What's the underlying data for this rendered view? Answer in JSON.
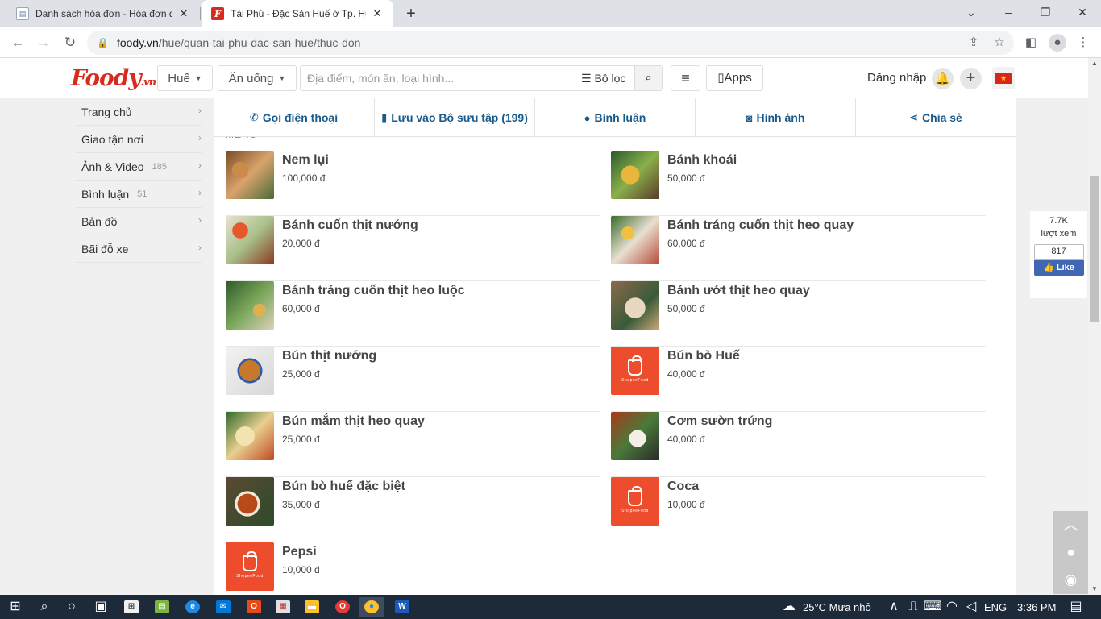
{
  "browser": {
    "tabs": [
      {
        "title": "Danh sách hóa đơn - Hóa đơn điện tử",
        "active": false
      },
      {
        "title": "Tài Phú - Đặc Sản Huế ở Tp. Huế",
        "active": true
      }
    ],
    "url_host": "foody.vn",
    "url_path": "/hue/quan-tai-phu-dac-san-hue/thuc-don"
  },
  "header": {
    "logo_text": "Foody",
    "logo_suffix": ".vn",
    "city": "Huế",
    "category": "Ăn uống",
    "search_placeholder": "Địa điểm, món ăn, loại hình...",
    "filter_label": "Bộ lọc",
    "apps_label": "Apps",
    "login_label": "Đăng nhập",
    "flag_symbol": "★"
  },
  "sidebar": {
    "items": [
      {
        "label": "Trang chủ",
        "count": ""
      },
      {
        "label": "Giao tận nơi",
        "count": ""
      },
      {
        "label": "Ảnh & Video",
        "count": "185"
      },
      {
        "label": "Bình luận",
        "count": "51"
      },
      {
        "label": "Bản đồ",
        "count": ""
      },
      {
        "label": "Bãi đỗ xe",
        "count": ""
      }
    ]
  },
  "actions": [
    {
      "label": "Gọi điện thoại",
      "icon": "phone-icon"
    },
    {
      "label": "Lưu vào Bộ sưu tập (199)",
      "icon": "bookmark-icon"
    },
    {
      "label": "Bình luận",
      "icon": "comment-icon"
    },
    {
      "label": "Hình ảnh",
      "icon": "camera-icon"
    },
    {
      "label": "Chia sẻ",
      "icon": "share-icon"
    }
  ],
  "menu": {
    "heading": "MENU",
    "left": [
      {
        "name": "Nem lụi",
        "price": "100,000 đ",
        "image": "photo-grill"
      },
      {
        "name": "Bánh cuốn thịt nướng",
        "price": "20,000 đ",
        "image": "photo-rolls"
      },
      {
        "name": "Bánh tráng cuốn thịt heo luộc",
        "price": "60,000 đ",
        "image": "photo-herbs"
      },
      {
        "name": "Bún thịt nướng",
        "price": "25,000 đ",
        "image": "photo-noodle"
      },
      {
        "name": "Bún mắm thịt heo quay",
        "price": "25,000 đ",
        "image": "photo-noodle-bowl"
      },
      {
        "name": "Bún bò huế đặc biệt",
        "price": "35,000 đ",
        "image": "photo-soup"
      },
      {
        "name": "Pepsi",
        "price": "10,000 đ",
        "image": "shopeefood-placeholder"
      }
    ],
    "right": [
      {
        "name": "Bánh khoái",
        "price": "50,000 đ",
        "image": "photo-pancake"
      },
      {
        "name": "Bánh tráng cuốn thịt heo quay",
        "price": "60,000 đ",
        "image": "photo-platter"
      },
      {
        "name": "Bánh ướt thịt heo quay",
        "price": "50,000 đ",
        "image": "photo-pork"
      },
      {
        "name": "Bún bò Huế",
        "price": "40,000 đ",
        "image": "shopeefood-placeholder"
      },
      {
        "name": "Cơm sườn trứng",
        "price": "40,000 đ",
        "image": "photo-rice"
      },
      {
        "name": "Coca",
        "price": "10,000 đ",
        "image": "shopeefood-placeholder"
      }
    ],
    "placeholder_brand": "ShopeeFood"
  },
  "social": {
    "views": "7.7K",
    "views_label": "lượt xem",
    "like_count": "817",
    "like_label": "Like"
  },
  "taskbar": {
    "weather": "25°C Mưa nhỏ",
    "language": "ENG",
    "time": "3:36 PM"
  },
  "colors": {
    "brand_red": "#d72b1e",
    "action_blue": "#1a5a8a",
    "shopee_orange": "#ee4d2d",
    "facebook_blue": "#4267b2"
  }
}
